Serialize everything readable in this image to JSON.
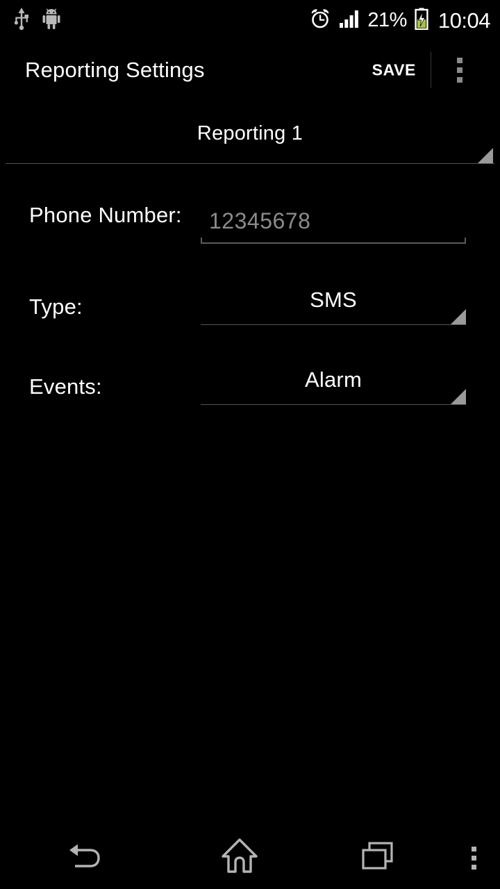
{
  "status_bar": {
    "left_icons": [
      {
        "name": "usb-icon",
        "label": "USB connected"
      },
      {
        "name": "android-robot-icon",
        "label": "Android system"
      }
    ],
    "right_icons": [
      {
        "name": "alarm-clock-icon",
        "label": "Alarm set"
      },
      {
        "name": "signal-bars-icon",
        "label": "Mobile signal"
      }
    ],
    "battery_percent": "21%",
    "battery_icon": "battery-charging-icon",
    "clock": "10:04"
  },
  "action_bar": {
    "title": "Reporting Settings",
    "save_label": "SAVE",
    "overflow_icon": "overflow-menu-icon"
  },
  "top_spinner": {
    "name": "reporting-selector",
    "value": "Reporting 1",
    "dropdown_icon": "dropdown-triangle-icon"
  },
  "form": {
    "rows": [
      {
        "label": "Phone Number:",
        "field_type": "edittext",
        "value": "",
        "placeholder": "12345678"
      },
      {
        "label": "Type:",
        "field_type": "spinner",
        "value": "SMS",
        "dropdown_icon": "dropdown-triangle-icon"
      },
      {
        "label": "Events:",
        "field_type": "spinner",
        "value": "Alarm",
        "dropdown_icon": "dropdown-triangle-icon"
      }
    ]
  },
  "nav_bar": {
    "back": "back-icon",
    "home": "home-icon",
    "recents": "recent-apps-icon",
    "menu": "menu-icon"
  },
  "colors": {
    "background": "#000000",
    "primary_text": "#ffffff",
    "hint_text": "#8b8b8b",
    "rule": "#555555",
    "triangle": "#9a9a9a",
    "nav_icon": "#b4b4b4",
    "battery_fill": "#a4c639"
  }
}
